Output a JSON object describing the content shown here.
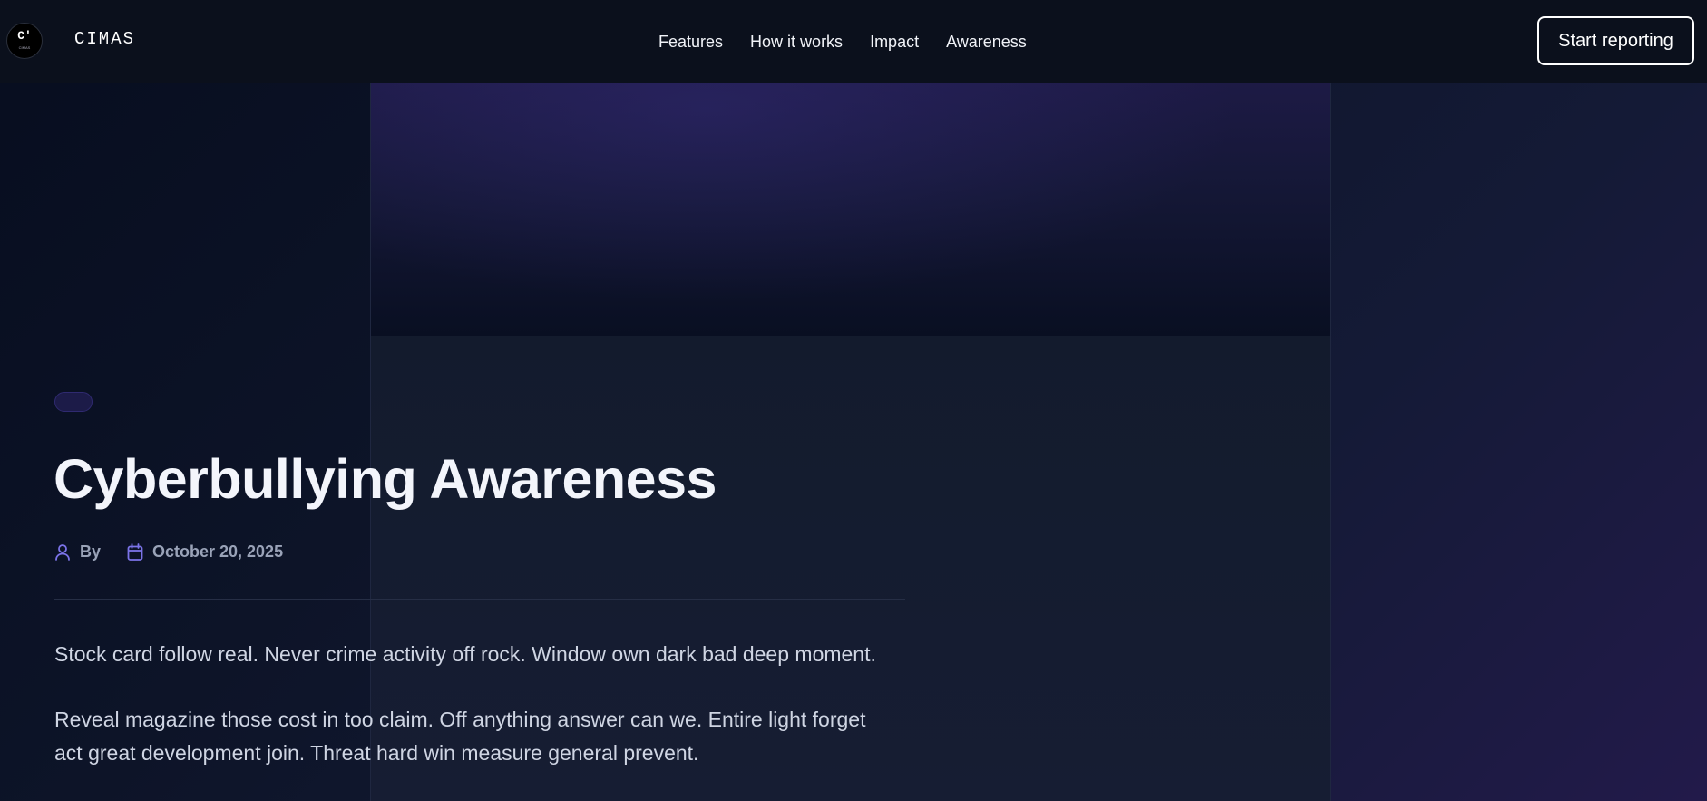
{
  "header": {
    "brand": "CIMAS",
    "logo_mark": "C'",
    "logo_subtext": "CIMAS",
    "nav": [
      "Features",
      "How it works",
      "Impact",
      "Awareness"
    ],
    "cta_label": "Start reporting"
  },
  "article": {
    "category_tag": "",
    "title": "Cyberbullying Awareness",
    "author_label": "By",
    "author_name": "",
    "date": "October 20, 2025",
    "paragraphs": [
      "Stock card follow real. Never crime activity off rock. Window own dark bad deep moment.",
      "Reveal magazine those cost in too claim. Off anything answer can we. Entire light forget act great development join. Threat hard win measure general prevent."
    ]
  },
  "icons": {
    "author": "user-icon",
    "date": "calendar-icon"
  },
  "colors": {
    "accent_icon": "#7b73e8",
    "title_text": "#f3f5fb",
    "meta_text": "#9aa3b8",
    "tag_pill": "#1c1b48"
  }
}
